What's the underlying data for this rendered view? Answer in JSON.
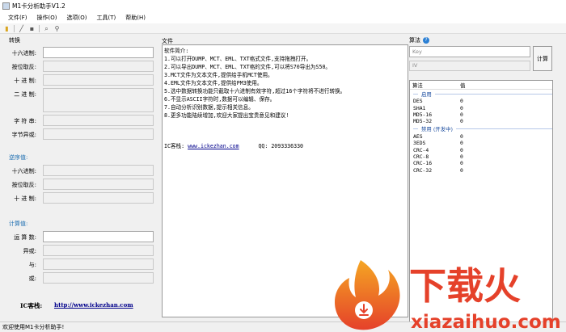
{
  "window": {
    "title": "M1卡分析助手V1.2"
  },
  "menu": [
    "文件(F)",
    "操作(O)",
    "选项(O)",
    "工具(T)",
    "帮助(H)"
  ],
  "toolbar_icons": [
    "open-folder-icon",
    "edit-icon",
    "save-icon",
    "search-icon",
    "zoom-icon"
  ],
  "left": {
    "convert_title": "转换",
    "convert_labels": [
      "十六进制:",
      "按位取反:",
      "十 进 制:",
      "二 进 制:",
      "字 符 串:",
      "字节异或:"
    ],
    "reverse_title": "逆序值:",
    "reverse_labels": [
      "十六进制:",
      "按位取反:",
      "十 进 制:"
    ],
    "calc_title": "计算值:",
    "calc_labels": [
      "运 算 数:",
      "异或:",
      "与:",
      "或:"
    ],
    "ic_label": "IC客栈:",
    "ic_link": "http://www.ickezhan.com"
  },
  "file": {
    "header": "文件",
    "lines": [
      "软件简介:",
      "1.可以打开DUMP、MCT、EML、TXT格式文件,支持拖拽打开。",
      "2.可以导出DUMP、MCT、EML、TXT格的文件,可以将S70导出为S50。",
      "3.MCT文件为文本文件,提供给手机MCT使用。",
      "4.EML文件为文本文件,提供给PM3使用。",
      "5.选中数据转换功能只截取十六进制有效字符,超过16个字符将不进行转换。",
      "6.不显示ASCII字符时,数据可以编辑、保存。",
      "7.自动分析识别数据,提示相关信息。",
      "8.更多功能陆续增加,欢迎大家提出宝贵意见和建议!"
    ],
    "ic_label": "IC客栈:",
    "ic_link": "www.ickezhan.com",
    "qq": "QQ: 2093336330"
  },
  "algo": {
    "header": "算法",
    "key_placeholder": "Key",
    "iv_placeholder": "IV",
    "calc_button": "计算",
    "col_algo": "算法",
    "col_value": "值",
    "enabled_group": "启用",
    "enabled_items": [
      {
        "name": "DES",
        "value": "0"
      },
      {
        "name": "SHA1",
        "value": "0"
      },
      {
        "name": "MD5-16",
        "value": "0"
      },
      {
        "name": "MD5-32",
        "value": "0"
      }
    ],
    "disabled_group": "禁用 (开发中)",
    "disabled_items": [
      {
        "name": "AES",
        "value": "0"
      },
      {
        "name": "3EDS",
        "value": "0"
      },
      {
        "name": "CRC-4",
        "value": "0"
      },
      {
        "name": "CRC-8",
        "value": "0"
      },
      {
        "name": "CRC-16",
        "value": "0"
      },
      {
        "name": "CRC-32",
        "value": "0"
      }
    ]
  },
  "status": {
    "text": "欢迎使用M1卡分析助手!"
  },
  "watermark": {
    "brand": "下载火",
    "site": "xiazaihuo.com"
  },
  "colors": {
    "accent_blue": "#1f6fb2",
    "link": "#00008b",
    "watermark_red": "#e5412a",
    "watermark_orange": "#f08a1c"
  }
}
